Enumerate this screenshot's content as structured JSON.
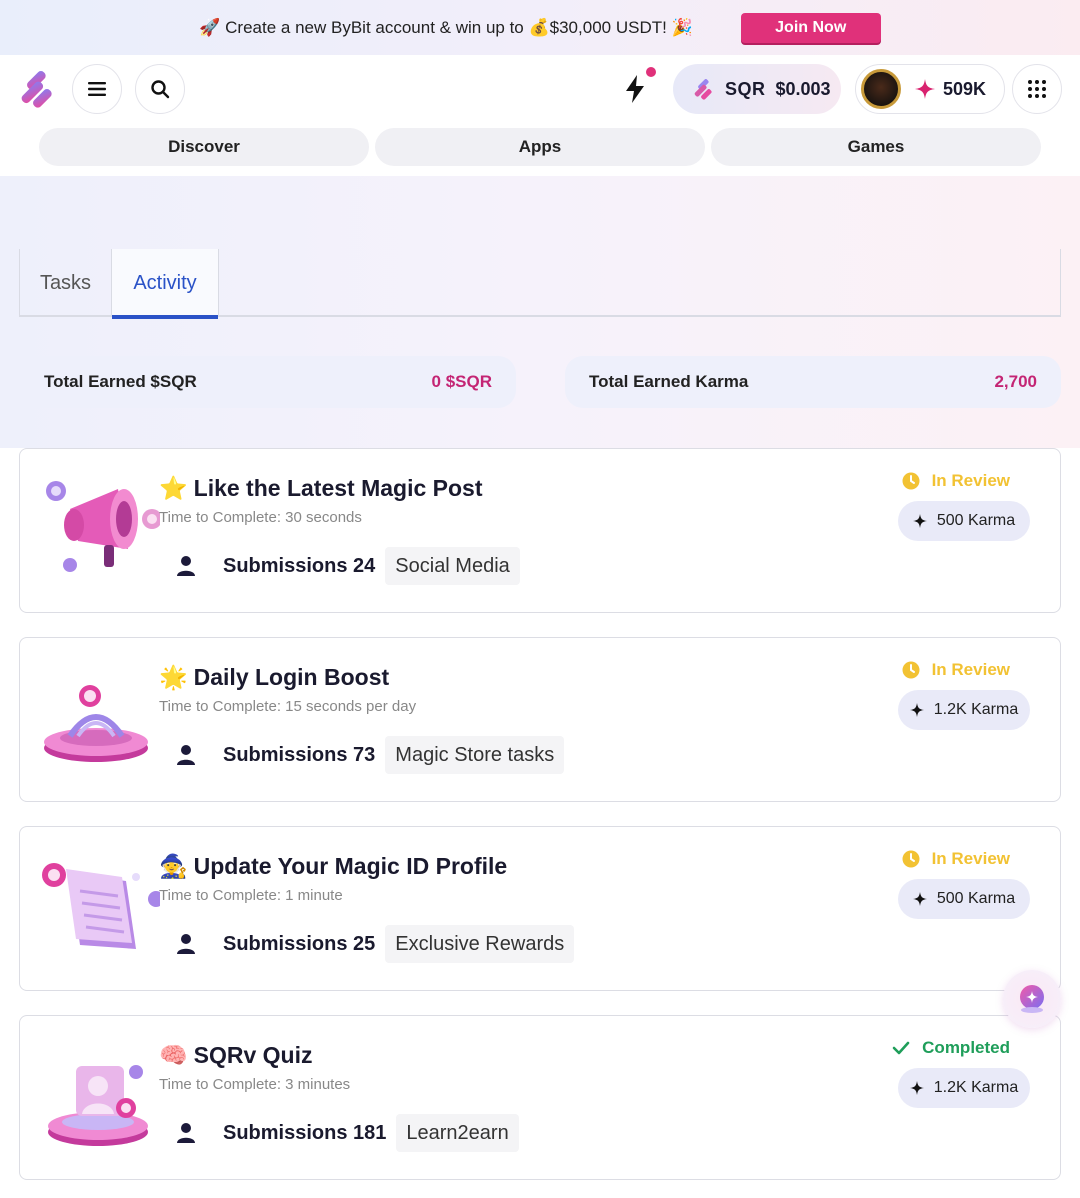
{
  "promo": {
    "text": "🚀 Create a new ByBit account & win up to 💰$30,000 USDT! 🎉",
    "button": "Join Now"
  },
  "header": {
    "token_symbol": "SQR",
    "token_price": "$0.003",
    "karma_balance": "509K"
  },
  "nav": {
    "items": [
      "Discover",
      "Apps",
      "Games"
    ]
  },
  "tabs": {
    "tasks": "Tasks",
    "activity": "Activity",
    "active": "Activity"
  },
  "stats": {
    "sqr_label": "Total Earned $SQR",
    "sqr_value": "0 $SQR",
    "karma_label": "Total Earned Karma",
    "karma_value": "2,700"
  },
  "activities": [
    {
      "emoji": "⭐",
      "title": "Like the Latest Magic Post",
      "time": "Time to Complete: 30 seconds",
      "submissions": "Submissions 24",
      "category": "Social Media",
      "status": "In Review",
      "reward": "500 Karma"
    },
    {
      "emoji": "🌟",
      "title": "Daily Login Boost",
      "time": "Time to Complete: 15 seconds per day",
      "submissions": "Submissions 73",
      "category": "Magic Store tasks",
      "status": "In Review",
      "reward": "1.2K Karma"
    },
    {
      "emoji": "🧙",
      "title": "Update Your Magic ID Profile",
      "time": "Time to Complete: 1 minute",
      "submissions": "Submissions 25",
      "category": "Exclusive Rewards",
      "status": "In Review",
      "reward": "500 Karma"
    },
    {
      "emoji": "🧠",
      "title": "SQRv Quiz",
      "time": "Time to Complete: 3 minutes",
      "submissions": "Submissions 181",
      "category": "Learn2earn",
      "status": "Completed",
      "reward": "1.2K Karma"
    }
  ],
  "colors": {
    "accent_pink": "#e0317a",
    "accent_blue": "#2a52c7",
    "review_yellow": "#f2c233",
    "completed_green": "#1f9e5a"
  }
}
